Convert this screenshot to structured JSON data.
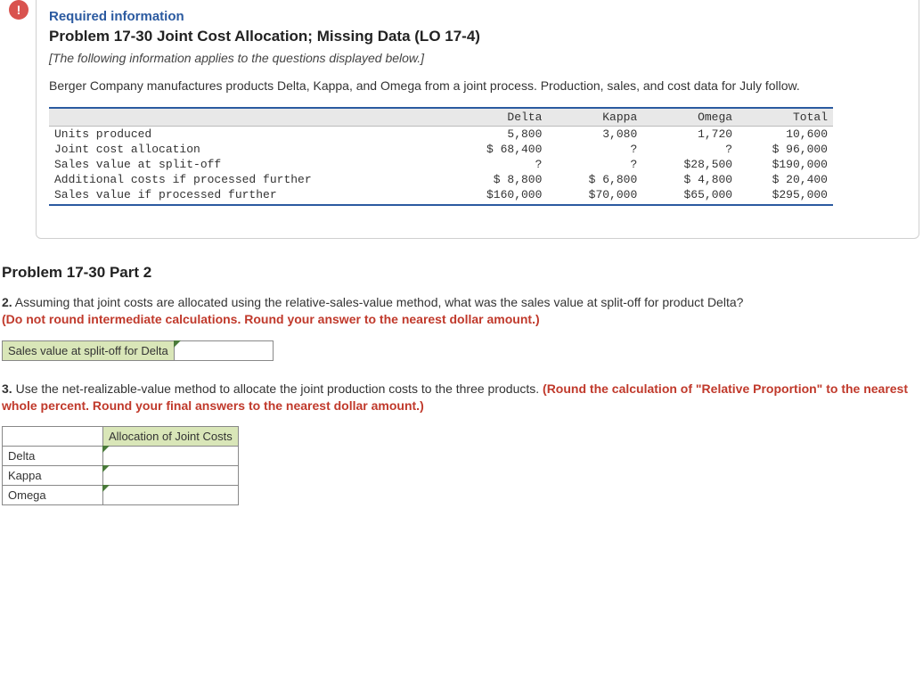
{
  "alert_glyph": "!",
  "header": {
    "required": "Required information",
    "title": "Problem 17-30 Joint Cost Allocation; Missing Data (LO 17-4)",
    "note": "[The following information applies to the questions displayed below.]",
    "intro": "Berger Company manufactures products Delta, Kappa, and Omega from a joint process. Production, sales, and cost data for July follow."
  },
  "data_table": {
    "cols": [
      "Delta",
      "Kappa",
      "Omega",
      "Total"
    ],
    "rows": [
      {
        "label": "Units produced",
        "vals": [
          "5,800",
          "3,080",
          "1,720",
          "10,600"
        ]
      },
      {
        "label": "Joint cost allocation",
        "vals": [
          "$ 68,400",
          "?",
          "?",
          "$ 96,000"
        ]
      },
      {
        "label": "Sales value at split-off",
        "vals": [
          "?",
          "?",
          "$28,500",
          "$190,000"
        ]
      },
      {
        "label": "Additional costs if processed further",
        "vals": [
          "$  8,800",
          "$ 6,800",
          "$ 4,800",
          "$ 20,400"
        ]
      },
      {
        "label": "Sales value if processed further",
        "vals": [
          "$160,000",
          "$70,000",
          "$65,000",
          "$295,000"
        ]
      }
    ]
  },
  "part2_heading": "Problem 17-30 Part 2",
  "q2": {
    "num": "2.",
    "text": " Assuming that joint costs are allocated using the relative-sales-value method, what was the sales value at split-off for product Delta? ",
    "red": "(Do not round intermediate calculations. Round your answer to the nearest dollar amount.)"
  },
  "q2_answer_label": "Sales value at split-off for Delta",
  "q3": {
    "num": "3.",
    "text": " Use the net-realizable-value method to allocate the joint production costs to the three products. ",
    "red": "(Round the calculation of \"Relative Proportion\" to the nearest whole percent. Round your final answers to the nearest dollar amount.)"
  },
  "alloc_table": {
    "header": "Allocation of Joint Costs",
    "rows": [
      "Delta",
      "Kappa",
      "Omega"
    ]
  }
}
